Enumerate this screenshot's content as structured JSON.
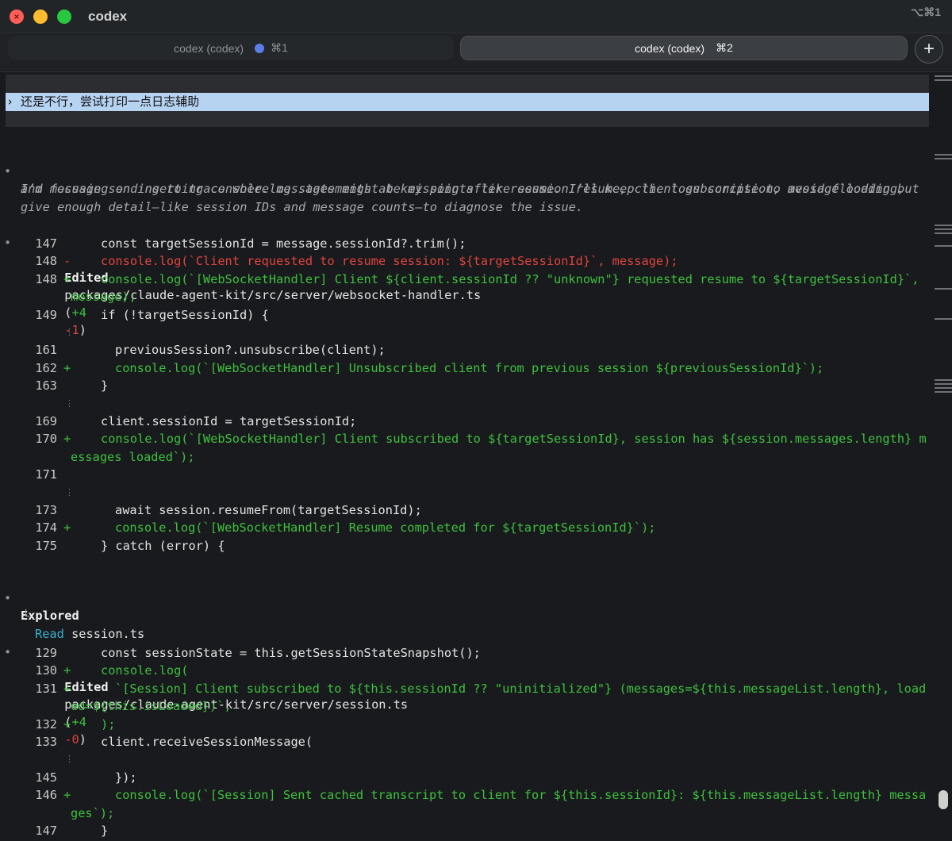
{
  "window": {
    "title": "codex",
    "shortcut_hint": "⌥⌘1"
  },
  "tabs": [
    {
      "label": "codex (codex)",
      "shortcut": "⌘1",
      "has_activity_dot": true,
      "active": false
    },
    {
      "label": "codex (codex)",
      "shortcut": "⌘2",
      "has_activity_dot": false,
      "active": true
    }
  ],
  "new_tab_label": "+",
  "prompt": {
    "text": "› 还是不行，尝试打印一点日志辅助"
  },
  "thinking": {
    "bullet": "•",
    "lines": [
      "I’m focusing on inserting console.log statements at key points like session resume, client subscription, message loading,",
      "and message sending to trace where messages might be missing after resume. I’ll keep the logs concise to avoid flooding but",
      "give enough detail—like session IDs and message counts—to diagnose the issue."
    ]
  },
  "edit1": {
    "bullet": "•",
    "label": "Edited",
    "path": "packages/claude-agent-kit/src/server/websocket-handler.ts",
    "stats_open": "(",
    "added": "+4",
    "removed": "-1",
    "stats_close": ")",
    "rows": [
      {
        "num": "147",
        "sign": "",
        "kind": "ctx",
        "text": "const targetSessionId = message.sessionId?.trim();"
      },
      {
        "num": "148",
        "sign": "-",
        "kind": "del",
        "text": "console.log(`Client requested to resume session: ${targetSessionId}`, message);"
      },
      {
        "num": "148",
        "sign": "+",
        "kind": "add",
        "text": "console.log(`[WebSocketHandler] Client ${client.sessionId ?? \"unknown\"} requested resume to ${targetSessionId}`,"
      },
      {
        "num": "",
        "sign": "",
        "kind": "add-cont",
        "text": "message);"
      },
      {
        "num": "149",
        "sign": "",
        "kind": "ctx",
        "text": "if (!targetSessionId) {"
      },
      {
        "num": "",
        "sign": "",
        "kind": "gap",
        "text": "⋮"
      },
      {
        "num": "161",
        "sign": "",
        "kind": "ctx2",
        "text": "previousSession?.unsubscribe(client);"
      },
      {
        "num": "162",
        "sign": "+",
        "kind": "add2",
        "text": "console.log(`[WebSocketHandler] Unsubscribed client from previous session ${previousSessionId}`);"
      },
      {
        "num": "163",
        "sign": "",
        "kind": "ctx",
        "text": "}"
      },
      {
        "num": "",
        "sign": "",
        "kind": "gap",
        "text": "⋮"
      },
      {
        "num": "169",
        "sign": "",
        "kind": "ctx",
        "text": "client.sessionId = targetSessionId;"
      },
      {
        "num": "170",
        "sign": "+",
        "kind": "add",
        "text": "console.log(`[WebSocketHandler] Client subscribed to ${targetSessionId}, session has ${session.messages.length} m"
      },
      {
        "num": "",
        "sign": "",
        "kind": "add-cont",
        "text": "essages loaded`);"
      },
      {
        "num": "171",
        "sign": "",
        "kind": "ctx",
        "text": ""
      },
      {
        "num": "",
        "sign": "",
        "kind": "gap",
        "text": "⋮"
      },
      {
        "num": "173",
        "sign": "",
        "kind": "ctx2",
        "text": "await session.resumeFrom(targetSessionId);"
      },
      {
        "num": "174",
        "sign": "+",
        "kind": "add2",
        "text": "console.log(`[WebSocketHandler] Resume completed for ${targetSessionId}`);"
      },
      {
        "num": "175",
        "sign": "",
        "kind": "ctx",
        "text": "} catch (error) {"
      }
    ]
  },
  "explored": {
    "bullet": "•",
    "label": "Explored",
    "tree_glyph": "└",
    "action": "Read",
    "target": "session.ts"
  },
  "edit2": {
    "bullet": "•",
    "label": "Edited",
    "path": "packages/claude-agent-kit/src/server/session.ts",
    "stats_open": "(",
    "added": "+4",
    "removed": "-0",
    "stats_close": ")",
    "rows": [
      {
        "num": "129",
        "sign": "",
        "kind": "ctx",
        "text": "const sessionState = this.getSessionStateSnapshot();"
      },
      {
        "num": "130",
        "sign": "+",
        "kind": "add",
        "text": "console.log("
      },
      {
        "num": "131",
        "sign": "+",
        "kind": "add2",
        "text": "`[Session] Client subscribed to ${this.sessionId ?? \"uninitialized\"} (messages=${this.messageList.length}, load"
      },
      {
        "num": "",
        "sign": "",
        "kind": "add-cont",
        "text": "ed=${this.isLoaded})`,"
      },
      {
        "num": "132",
        "sign": "+",
        "kind": "add",
        "text": ");"
      },
      {
        "num": "133",
        "sign": "",
        "kind": "ctx",
        "text": "client.receiveSessionMessage("
      },
      {
        "num": "",
        "sign": "",
        "kind": "gap",
        "text": "⋮"
      },
      {
        "num": "145",
        "sign": "",
        "kind": "ctx2",
        "text": "});"
      },
      {
        "num": "146",
        "sign": "+",
        "kind": "add2",
        "text": "console.log(`[Session] Sent cached transcript to client for ${this.sessionId}: ${this.messageList.length} messa"
      },
      {
        "num": "",
        "sign": "",
        "kind": "add-cont",
        "text": "ges`);"
      },
      {
        "num": "147",
        "sign": "",
        "kind": "ctx",
        "text": "}"
      }
    ]
  }
}
